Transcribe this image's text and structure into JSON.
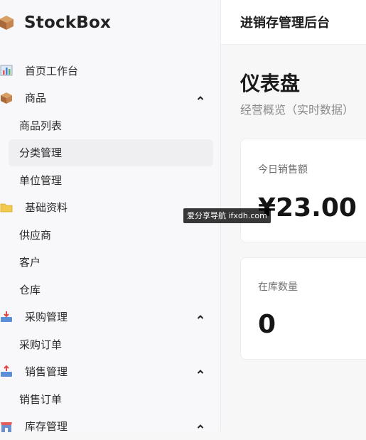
{
  "brand": {
    "name": "StockBox"
  },
  "header": {
    "title": "进销存管理后台"
  },
  "menu": {
    "items": [
      {
        "label": "首页工作台",
        "type": "top",
        "icon": "chart-icon"
      },
      {
        "label": "商品",
        "type": "top",
        "icon": "box-icon",
        "expanded": true
      },
      {
        "label": "商品列表",
        "type": "sub"
      },
      {
        "label": "分类管理",
        "type": "sub",
        "active": true
      },
      {
        "label": "单位管理",
        "type": "sub"
      },
      {
        "label": "基础资料",
        "type": "top",
        "icon": "folder-icon"
      },
      {
        "label": "供应商",
        "type": "sub"
      },
      {
        "label": "客户",
        "type": "sub"
      },
      {
        "label": "仓库",
        "type": "sub"
      },
      {
        "label": "采购管理",
        "type": "top",
        "icon": "inbox-tray-icon",
        "expanded": true
      },
      {
        "label": "采购订单",
        "type": "sub"
      },
      {
        "label": "销售管理",
        "type": "top",
        "icon": "outbox-tray-icon",
        "expanded": true
      },
      {
        "label": "销售订单",
        "type": "sub"
      },
      {
        "label": "库存管理",
        "type": "top",
        "icon": "shop-icon",
        "expanded": true
      }
    ]
  },
  "dashboard": {
    "title": "仪表盘",
    "subtitle": "经营概览（实时数据）",
    "cards": [
      {
        "label": "今日销售额",
        "value": "¥23.00"
      },
      {
        "label": "在库数量",
        "value": "0"
      }
    ]
  },
  "watermark": {
    "text": "爱分享导航 ifxdh.com"
  },
  "colors": {
    "accent": "#1a1a1a",
    "sidebar_bg": "#f8f8fa",
    "active_bg": "#efeff2",
    "muted": "#8a8a8a"
  }
}
